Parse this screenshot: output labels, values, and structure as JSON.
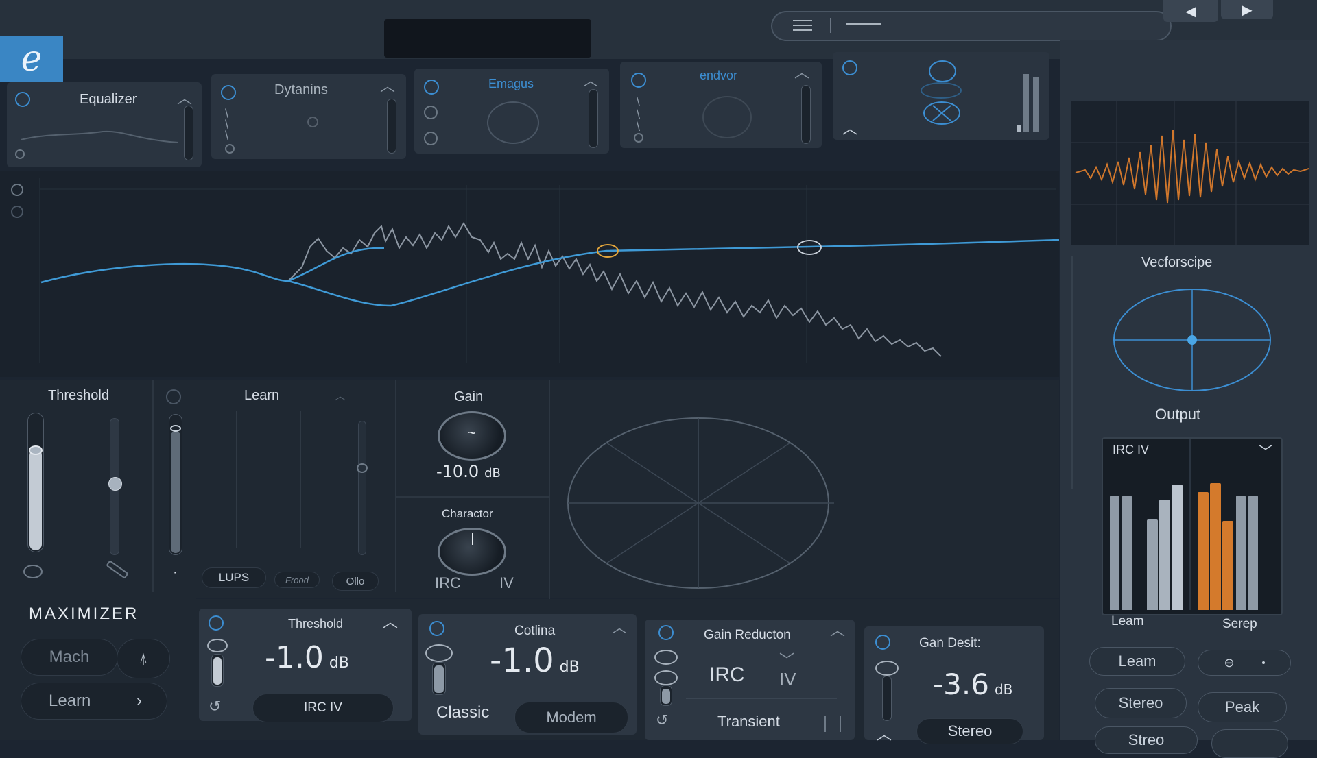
{
  "app": {
    "logo_letter": "e"
  },
  "topbar": {
    "display_text": ""
  },
  "modules": [
    {
      "label": "Equalizer"
    },
    {
      "label": "Dytanins"
    },
    {
      "label": "Emagus"
    },
    {
      "label": "endvor"
    },
    {
      "label": ""
    }
  ],
  "vectorscope": {
    "label": "Vecforscipe"
  },
  "output": {
    "label": "Output",
    "preset": "IRC IV",
    "left_label": "Leam",
    "right_label": "Serep",
    "buttons": {
      "learn": "Leam",
      "stereo": "Stereo",
      "peak": "Peak",
      "bottom": "Streo"
    },
    "left_levels": [
      0.76,
      0.76
    ],
    "mid_levels": [
      0.6,
      0.73,
      0.83
    ],
    "right_levels": [
      0.78,
      0.84,
      0.59,
      0.76,
      0.76
    ],
    "accent": "#d47a2c"
  },
  "controls": {
    "threshold": {
      "label": "Threshold",
      "fill": 0.72,
      "slider2": 0.53
    },
    "learn": {
      "label": "Learn",
      "fader": 0.87,
      "buttons": [
        "LUPS",
        "Frood",
        "Ollo"
      ],
      "dot": "·"
    },
    "gain": {
      "label": "Gain",
      "value": "-10.0",
      "unit": "dB",
      "knob_glyph": "~"
    },
    "character": {
      "label": "Charactor",
      "left": "IRC",
      "right": "IV"
    }
  },
  "maximizer": {
    "title": "MAXIMIZER",
    "mach": "Mach",
    "learn": "Learn",
    "learn_arrow": "›"
  },
  "bottom_modules": [
    {
      "title": "Threshold",
      "value": "-1.0",
      "unit": "dB",
      "button": "IRC IV"
    },
    {
      "title": "Cotlina",
      "value": "-1.0",
      "unit": "dB",
      "option_a": "Classic",
      "option_b": "Modem"
    },
    {
      "title": "Gain Reducton",
      "irc": "IRC",
      "iv": "IV",
      "button": "Transient"
    },
    {
      "title": "Gan Desit:",
      "value": "-3.6",
      "unit": "dB",
      "button": "Stereo"
    }
  ],
  "colors": {
    "accent_blue": "#3c8ed2",
    "accent_orange": "#d47a2c",
    "bg": "#1c2531"
  }
}
